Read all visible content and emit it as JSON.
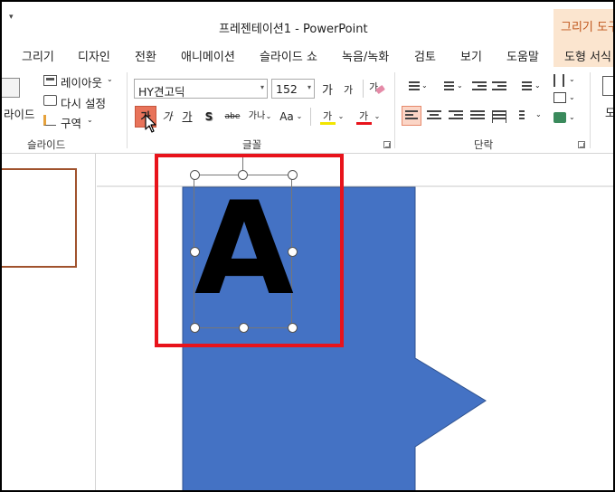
{
  "window": {
    "qat_arrow": "▾",
    "title": "프레젠테이션1  -  PowerPoint",
    "context_group": "그리기 도구"
  },
  "tabs": {
    "draw": "그리기",
    "design": "디자인",
    "transitions": "전환",
    "animations": "애니메이션",
    "slideshow": "슬라이드 쇼",
    "record": "녹음/녹화",
    "review": "검토",
    "view": "보기",
    "help": "도움말",
    "shape_format": "도형 서식"
  },
  "ribbon": {
    "slides": {
      "new_slide_partial": "라이드",
      "layout": "레이아웃",
      "reset": "다시 설정",
      "section": "구역",
      "group_label": "슬라이드"
    },
    "font": {
      "font_name": "HY견고딕",
      "font_size": "152",
      "grow": "가",
      "shrink": "가",
      "clear": "가",
      "bold": "가",
      "italic": "가",
      "underline": "가",
      "shadow": "S",
      "strike": "abe",
      "spacing": "가나",
      "case": "Aa",
      "highlight": "가",
      "font_color": "가",
      "group_label": "글꼴"
    },
    "paragraph": {
      "group_label": "단락"
    },
    "drawing_partial": "도"
  },
  "slide": {
    "text": "A"
  },
  "colors": {
    "shape_fill": "#4472c4",
    "highlight_box": "#e8131b",
    "bold_active": "#e8735a",
    "context_tab": "#fbe5cf",
    "thumb_border": "#a0522d"
  }
}
